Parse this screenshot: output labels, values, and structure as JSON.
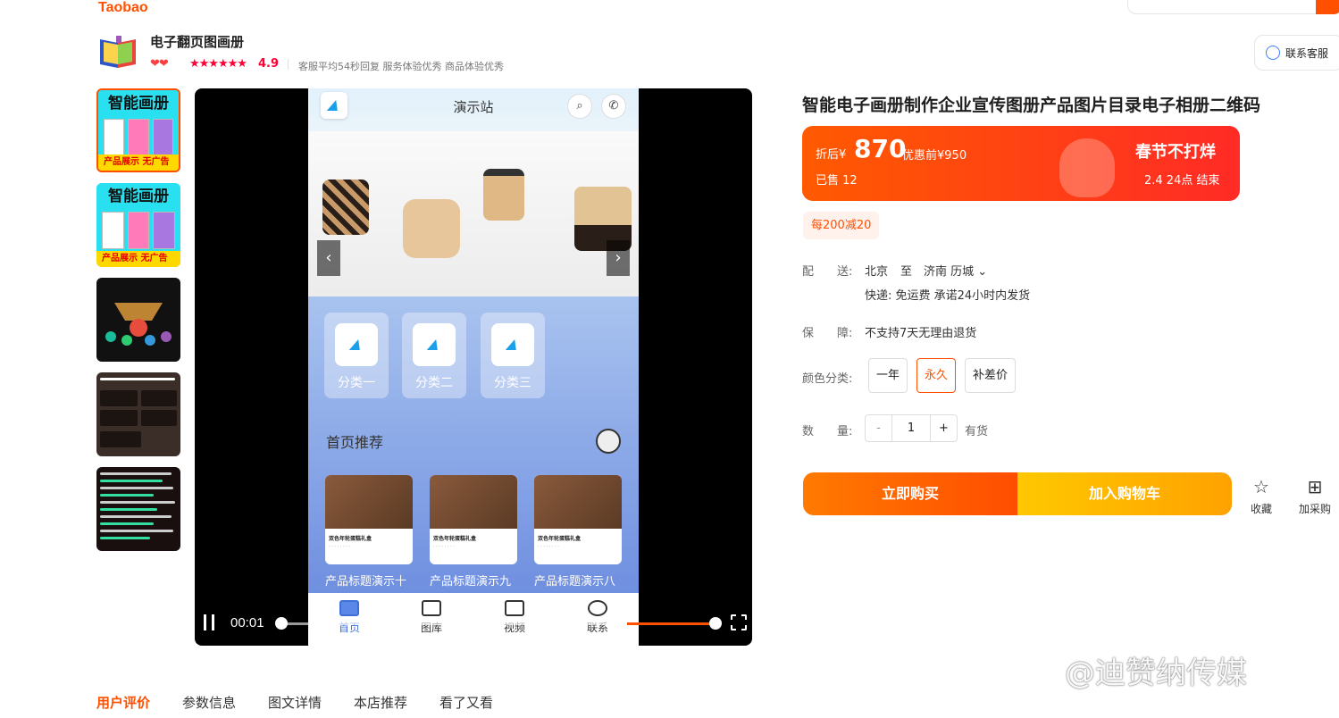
{
  "header": {
    "brand": "Taobao"
  },
  "shop": {
    "name": "电子翻页图画册",
    "hearts": "❤❤",
    "stars": "★★★★★★",
    "score": "4.9",
    "info": "客服平均54秒回复 服务体验优秀 商品体验优秀",
    "contact_label": "联系客服"
  },
  "thumbs": [
    {
      "title": "智能画册",
      "bottom": "产品展示 无广告"
    },
    {
      "title": "智能画册",
      "bottom": "产品展示 无广告"
    }
  ],
  "video": {
    "phone_title": "演示站",
    "categories": [
      "分类一",
      "分类二",
      "分类三"
    ],
    "section_title": "首页推荐",
    "cards": [
      {
        "name": "双色年轮蛋糕礼盒",
        "title": "产品标题演示十"
      },
      {
        "name": "双色年轮蛋糕礼盒",
        "title": "产品标题演示九"
      },
      {
        "name": "双色年轮蛋糕礼盒",
        "title": "产品标题演示八"
      }
    ],
    "tabs": [
      "首页",
      "图库",
      "视频",
      "联系"
    ],
    "time_current": "00:01",
    "progress_fraction": 0.2
  },
  "product": {
    "title": "智能电子画册制作企业宣传图册产品图片目录电子相册二维码",
    "price_prefix": "折后¥",
    "price": "870",
    "original": "优惠前¥950",
    "sold": "已售 12",
    "promo": "春节不打烊",
    "promo_end": "2.4 24点  结束",
    "coupon": "每200减20",
    "shipping_label": "配　　送:",
    "shipping_from": "北京",
    "shipping_to_word": "至",
    "shipping_to": "济南 历城",
    "shipping_detail": "快递: 免运费  承诺24小时内发货",
    "guarantee_label": "保　　障:",
    "guarantee": "不支持7天无理由退货",
    "color_label": "颜色分类:",
    "options": [
      "一年",
      "永久",
      "补差价"
    ],
    "qty_label": "数　　量:",
    "qty": "1",
    "stock": "有货",
    "buy": "立即购买",
    "cart": "加入购物车",
    "favorite": "收藏",
    "add_list": "加采购"
  },
  "bottom_tabs": [
    "用户评价",
    "参数信息",
    "图文详情",
    "本店推荐",
    "看了又看"
  ],
  "watermark": "@迪赞纳传媒",
  "colors": {
    "accent": "#ff5000",
    "price_red": "#ff0036"
  }
}
